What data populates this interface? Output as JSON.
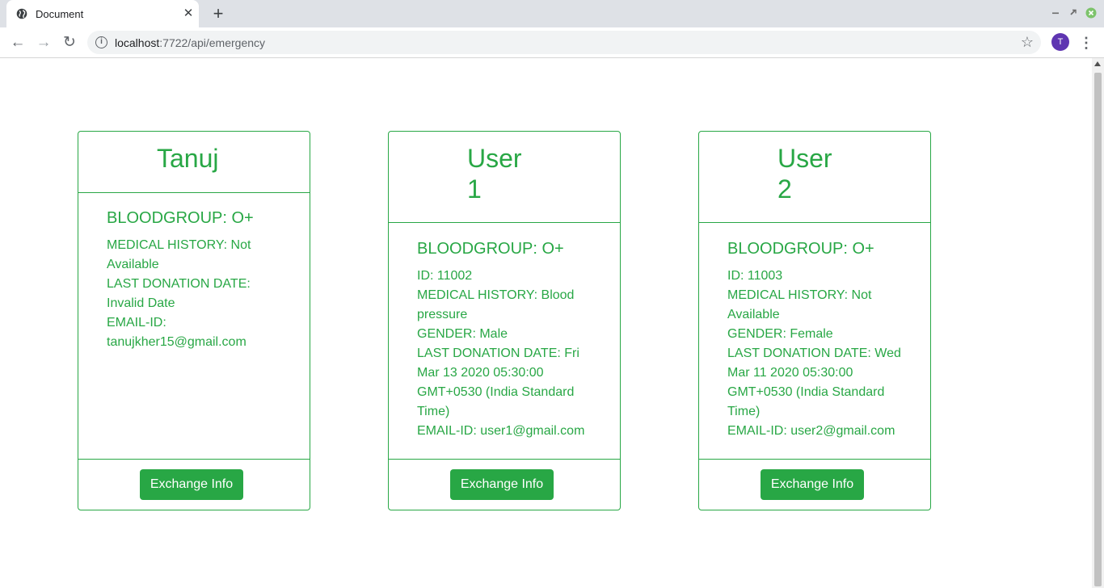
{
  "browser": {
    "tab_title": "Document",
    "url_host": "localhost",
    "url_rest": ":7722/api/emergency",
    "profile_initial": "T"
  },
  "cards": [
    {
      "name": "Tanuj",
      "bloodgroup": "BLOODGROUP: O+",
      "lines": [
        "MEDICAL HISTORY: Not",
        "Available",
        "LAST DONATION DATE:",
        "Invalid Date",
        "EMAIL-ID:",
        "tanujkher15@gmail.com"
      ],
      "button_label": "Exchange Info"
    },
    {
      "name_line1": "User",
      "name_line2": "1",
      "bloodgroup": "BLOODGROUP: O+",
      "lines": [
        "ID: 11002",
        "MEDICAL HISTORY: Blood",
        "pressure",
        "GENDER: Male",
        "LAST DONATION DATE: Fri",
        "Mar 13 2020 05:30:00",
        "GMT+0530 (India Standard",
        "Time)",
        "EMAIL-ID: user1@gmail.com"
      ],
      "button_label": "Exchange Info"
    },
    {
      "name_line1": "User",
      "name_line2": "2",
      "bloodgroup": "BLOODGROUP: O+",
      "lines": [
        "ID: 11003",
        "MEDICAL HISTORY: Not",
        "Available",
        "GENDER: Female",
        "LAST DONATION DATE: Wed",
        "Mar 11 2020 05:30:00",
        "GMT+0530 (India Standard",
        "Time)",
        "EMAIL-ID: user2@gmail.com"
      ],
      "button_label": "Exchange Info"
    }
  ],
  "colors": {
    "accent": "#28a745",
    "avatar": "#5e35b1"
  }
}
